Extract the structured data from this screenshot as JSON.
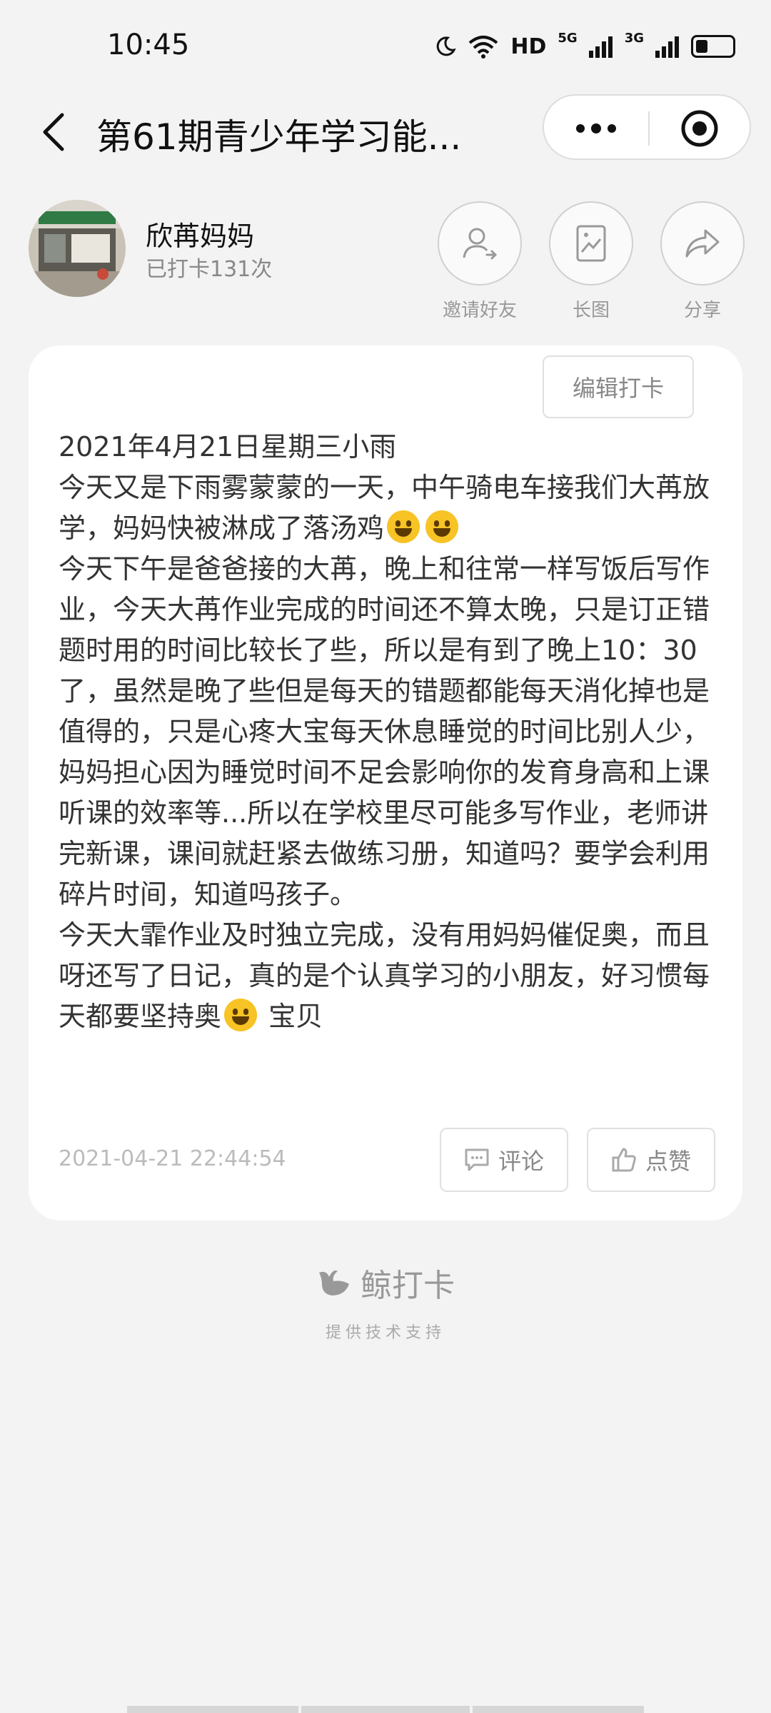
{
  "status_bar": {
    "time": "10:45",
    "network_label": "HD",
    "signal_1": "5G",
    "signal_2": "3G"
  },
  "navbar": {
    "title": "第61期青少年学习能...",
    "icons": [
      "back-arrow-icon",
      "more-dots-icon",
      "target-icon"
    ]
  },
  "profile": {
    "name": "欣苒妈妈",
    "checkin_count": "已打卡131次",
    "actions": [
      {
        "label": "邀请好友",
        "icon": "invite-user-icon"
      },
      {
        "label": "长图",
        "icon": "image-icon"
      },
      {
        "label": "分享",
        "icon": "share-icon"
      }
    ]
  },
  "post": {
    "edit_label": "编辑打卡",
    "line1": "2021年4月21日星期三小雨",
    "para1": "今天又是下雨雾蒙蒙的一天，中午骑电车接我们大苒放学，妈妈快被淋成了落汤鸡",
    "para2": "今天下午是爸爸接的大苒，晚上和往常一样写饭后写作业，今天大苒作业完成的时间还不算太晚，只是订正错题时用的时间比较长了些，所以是有到了晚上10：30了，虽然是晚了些但是每天的错题都能每天消化掉也是值得的，只是心疼大宝每天休息睡觉的时间比别人少，妈妈担心因为睡觉时间不足会影响你的发育身高和上课听课的效率等...所以在学校里尽可能多写作业，老师讲完新课，课间就赶紧去做练习册，知道吗？要学会利用碎片时间，知道吗孩子。",
    "para3": "今天大霏作业及时独立完成，没有用妈妈催促奥，而且呀还写了日记，真的是个认真学习的小朋友，好习惯每天都要坚持奥",
    "para3_tail": " 宝贝",
    "date": "2021-04-21 22:44:54",
    "comment_label": "评论",
    "like_label": "点赞"
  },
  "footer": {
    "brand": "鲸打卡",
    "tagline": "提供技术支持"
  }
}
